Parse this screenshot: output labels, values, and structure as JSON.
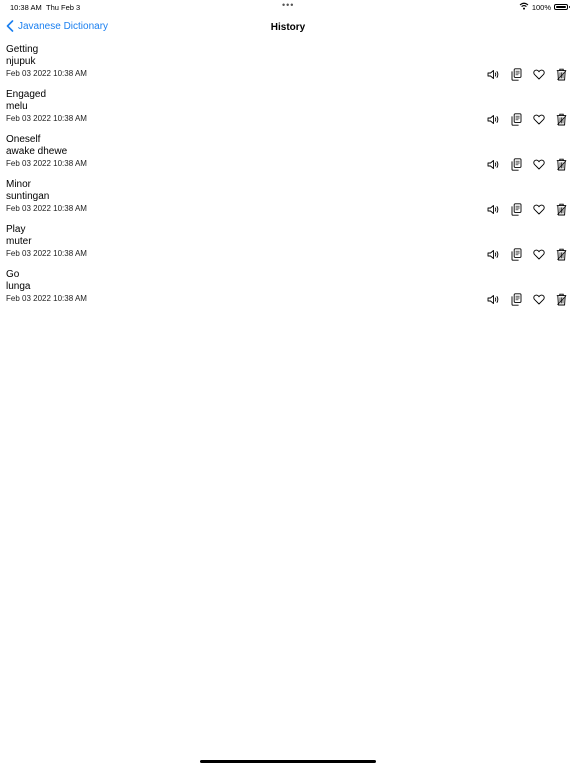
{
  "status_bar": {
    "time": "10:38 AM",
    "date": "Thu Feb 3",
    "multitask_dots": "•••",
    "battery_percent": "100%",
    "icons": [
      "wifi-icon",
      "battery-icon"
    ]
  },
  "nav": {
    "back_label": "Javanese Dictionary",
    "title": "History",
    "accent_color": "#1a7ff0"
  },
  "history": [
    {
      "word": "Getting",
      "translation": "njupuk",
      "timestamp": "Feb 03 2022 10:38 AM"
    },
    {
      "word": "Engaged",
      "translation": "melu",
      "timestamp": "Feb 03 2022 10:38 AM"
    },
    {
      "word": "Oneself",
      "translation": "awake dhewe",
      "timestamp": "Feb 03 2022 10:38 AM"
    },
    {
      "word": "Minor",
      "translation": "suntingan",
      "timestamp": "Feb 03 2022 10:38 AM"
    },
    {
      "word": "Play",
      "translation": "muter",
      "timestamp": "Feb 03 2022 10:38 AM"
    },
    {
      "word": "Go",
      "translation": "lunga",
      "timestamp": "Feb 03 2022 10:38 AM"
    }
  ],
  "row_action_icons": [
    "speaker-icon",
    "copy-icon",
    "heart-icon",
    "trash-icon"
  ]
}
